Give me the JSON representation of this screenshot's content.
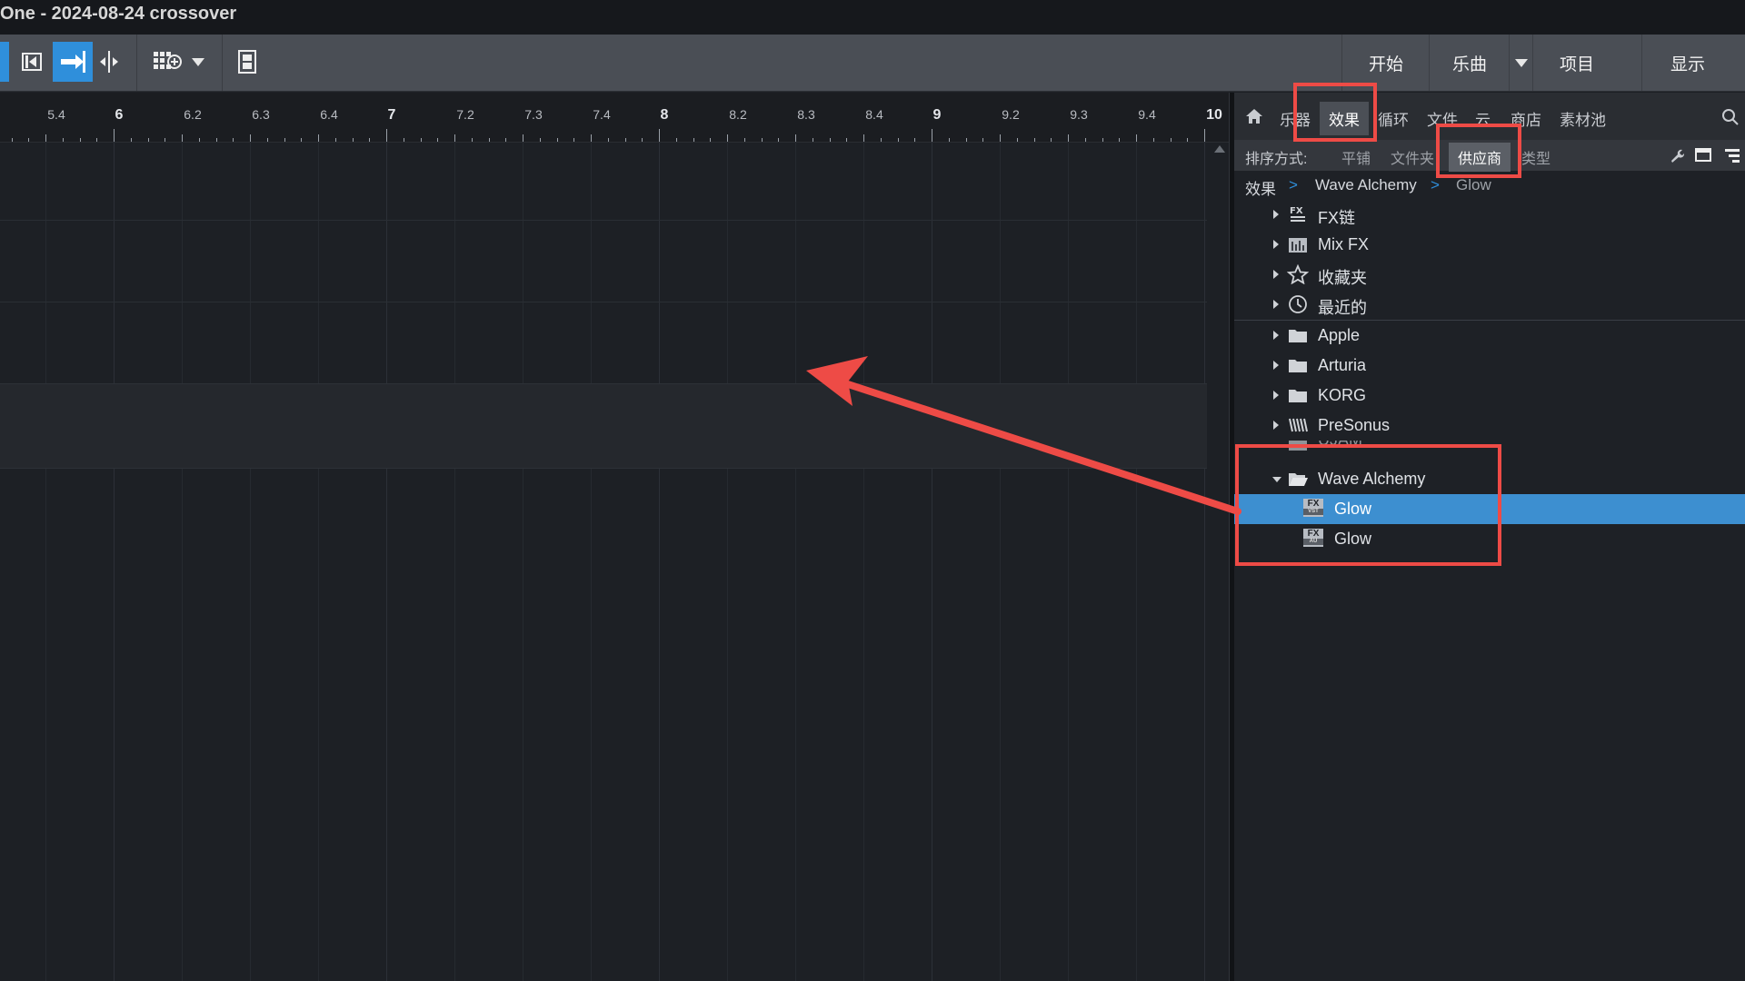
{
  "window": {
    "title": "One - 2024-08-24 crossover"
  },
  "toolbar": {
    "right_buttons": [
      "开始",
      "乐曲",
      "项目",
      "显示"
    ]
  },
  "ruler": {
    "labels": [
      "5.4",
      "6",
      "6.2",
      "6.3",
      "6.4",
      "7",
      "7.2",
      "7.3",
      "7.4",
      "8",
      "8.2",
      "8.3",
      "8.4",
      "9",
      "9.2",
      "9.3",
      "9.4",
      "10"
    ]
  },
  "browser": {
    "tabs": [
      "乐器",
      "效果",
      "循环",
      "文件",
      "云",
      "商店",
      "素材池"
    ],
    "selected_tab": "效果",
    "sort_label": "排序方式:",
    "sort_options": [
      "平铺",
      "文件夹",
      "供应商",
      "类型"
    ],
    "selected_sort": "供应商",
    "breadcrumb": [
      "效果",
      "Wave Alchemy",
      "Glow"
    ],
    "items": [
      {
        "label": "FX链",
        "icon": "fx-chain-icon",
        "expanded": false
      },
      {
        "label": "Mix FX",
        "icon": "mix-fx-icon",
        "expanded": false
      },
      {
        "label": "收藏夹",
        "icon": "star-icon",
        "expanded": false
      },
      {
        "label": "最近的",
        "icon": "clock-icon",
        "expanded": false
      },
      {
        "label": "Apple",
        "icon": "folder-icon",
        "expanded": false
      },
      {
        "label": "Arturia",
        "icon": "folder-icon",
        "expanded": false
      },
      {
        "label": "KORG",
        "icon": "folder-icon",
        "expanded": false
      },
      {
        "label": "PreSonus",
        "icon": "presonus-icon",
        "expanded": false
      },
      {
        "label": "UJAM",
        "icon": "folder-icon",
        "expanded": false
      },
      {
        "label": "Wave Alchemy",
        "icon": "folder-open-icon",
        "expanded": true
      },
      {
        "label": "Glow",
        "icon": "fx-plugin-icon",
        "child": true,
        "selected": true
      },
      {
        "label": "Glow",
        "icon": "fx-au-icon",
        "child": true,
        "selected": false
      }
    ]
  },
  "annotation": {
    "color": "#ee4b46"
  }
}
